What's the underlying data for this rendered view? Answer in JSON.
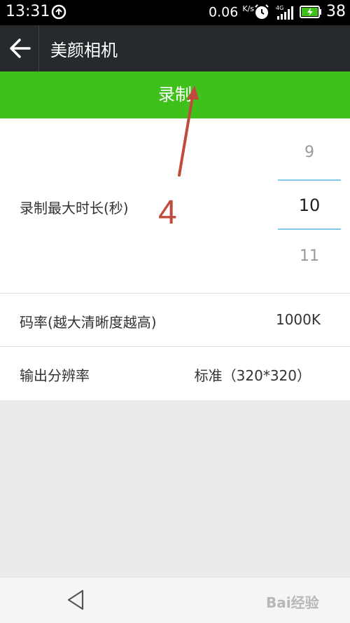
{
  "status_bar": {
    "time": "13:31",
    "network_speed": "0.06",
    "network_speed_unit": "K/s",
    "battery_level": "38",
    "icons": [
      "sync-icon",
      "alarm-icon",
      "signal-4g-icon",
      "battery-charging-icon"
    ]
  },
  "app_bar": {
    "title": "美颜相机",
    "back_icon": "arrow-left-icon"
  },
  "record_button": {
    "label": "录制"
  },
  "settings": {
    "duration": {
      "label": "录制最大时长(秒)",
      "picker_prev": "9",
      "picker_current": "10",
      "picker_next": "11"
    },
    "bitrate": {
      "label": "码率(越大清晰度越高)",
      "value": "1000K"
    },
    "resolution": {
      "label": "输出分辨率",
      "value": "标准（320*320）"
    }
  },
  "annotation": {
    "number": "4"
  },
  "nav_bar": {
    "back_icon": "triangle-back-icon",
    "watermark": "Bai经验"
  },
  "colors": {
    "record_green": "#3fc01b",
    "app_bar_dark": "#262a2c",
    "picker_divider": "#7ecae6",
    "annotation_red": "#c04a3c"
  }
}
